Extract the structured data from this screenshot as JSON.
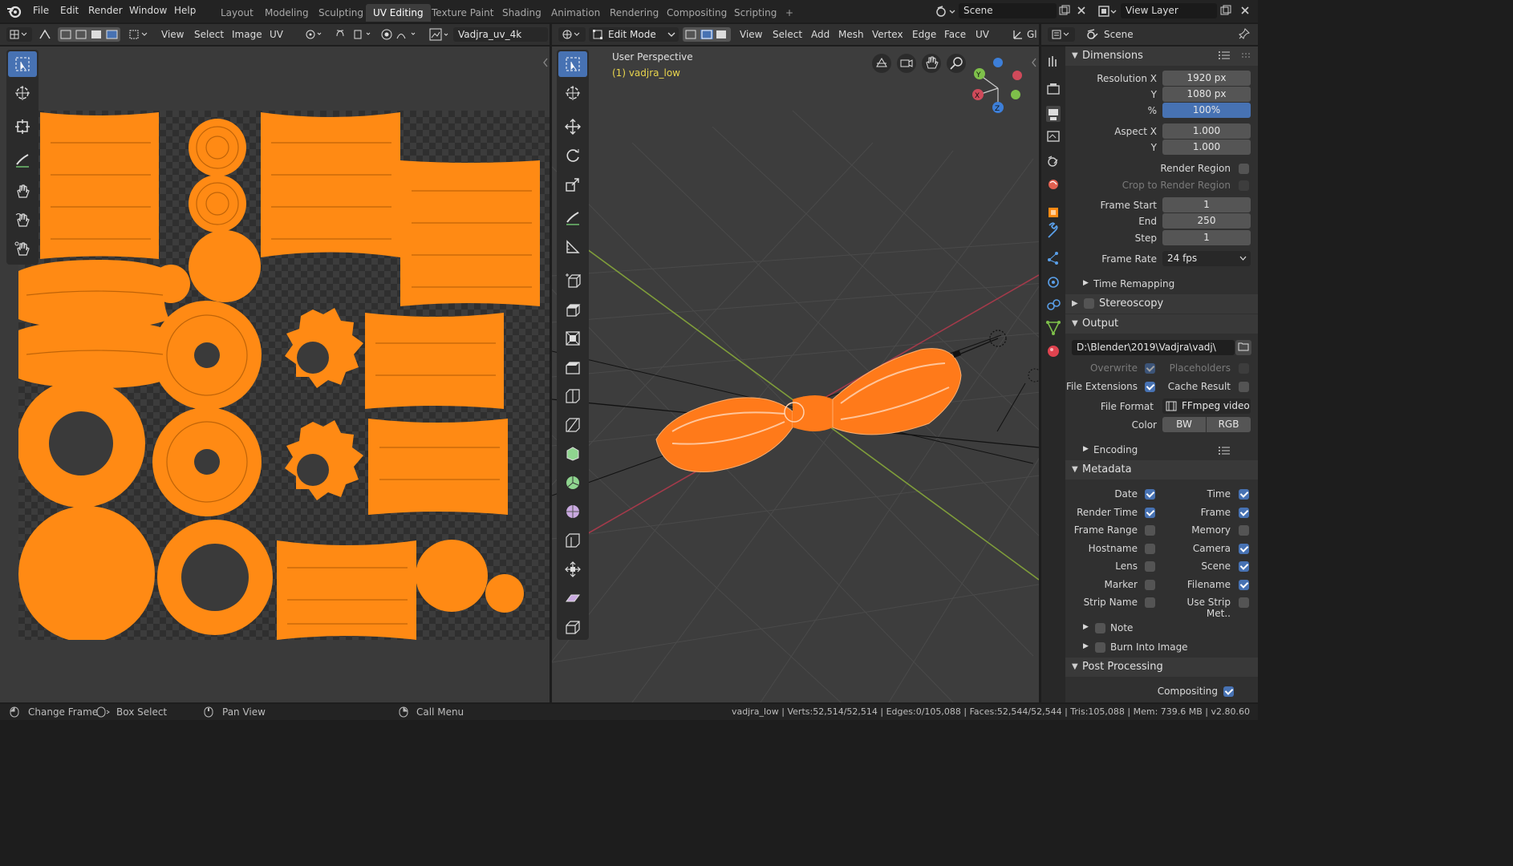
{
  "topbar": {
    "menus": [
      "File",
      "Edit",
      "Render",
      "Window",
      "Help"
    ],
    "workspaces": [
      "Layout",
      "Modeling",
      "Sculpting",
      "UV Editing",
      "Texture Paint",
      "Shading",
      "Animation",
      "Rendering",
      "Compositing",
      "Scripting"
    ],
    "active_workspace": "UV Editing",
    "add_tab": "+",
    "scene_name": "Scene",
    "view_layer": "View Layer"
  },
  "uv_editor": {
    "header_menus": [
      "View",
      "Select",
      "Image",
      "UV"
    ],
    "image_name": "Vadjra_uv_4k"
  },
  "viewport": {
    "mode": "Edit Mode",
    "header_menus": [
      "View",
      "Select",
      "Add",
      "Mesh",
      "Vertex",
      "Edge",
      "Face",
      "UV"
    ],
    "header_trailing": "Gl",
    "view_label": "User Perspective",
    "object_label": "(1) vadjra_low",
    "axes": {
      "x": "X",
      "y": "Y",
      "z": "Z"
    }
  },
  "properties": {
    "header_title": "Scene",
    "dimensions": {
      "title": "Dimensions",
      "resolution_x_label": "Resolution X",
      "resolution_x": "1920 px",
      "resolution_y_label": "Y",
      "resolution_y": "1080 px",
      "percent_label": "%",
      "percent": "100%",
      "aspect_x_label": "Aspect X",
      "aspect_x": "1.000",
      "aspect_y_label": "Y",
      "aspect_y": "1.000",
      "render_region": "Render Region",
      "crop_region": "Crop to Render Region",
      "frame_start_label": "Frame Start",
      "frame_start": "1",
      "end_label": "End",
      "end": "250",
      "step_label": "Step",
      "step": "1",
      "frame_rate_label": "Frame Rate",
      "frame_rate": "24 fps",
      "time_remapping": "Time Remapping"
    },
    "stereoscopy": "Stereoscopy",
    "output": {
      "title": "Output",
      "path": "D:\\Blender\\2019\\Vadjra\\vadj\\",
      "overwrite": "Overwrite",
      "placeholders": "Placeholders",
      "file_extensions": "File Extensions",
      "cache_result": "Cache Result",
      "file_format_label": "File Format",
      "file_format": "FFmpeg video",
      "color_label": "Color",
      "color_bw": "BW",
      "color_rgb": "RGB",
      "encoding": "Encoding"
    },
    "metadata": {
      "title": "Metadata",
      "date": "Date",
      "time": "Time",
      "render_time": "Render Time",
      "frame": "Frame",
      "frame_range": "Frame Range",
      "memory": "Memory",
      "hostname": "Hostname",
      "camera": "Camera",
      "lens": "Lens",
      "scene": "Scene",
      "marker": "Marker",
      "filename": "Filename",
      "strip_name": "Strip Name",
      "use_strip_meta": "Use Strip Met..",
      "note": "Note",
      "burn_into_image": "Burn Into Image"
    },
    "post_processing": {
      "title": "Post Processing",
      "compositing": "Compositing"
    }
  },
  "statusbar": {
    "change_frame": "Change Frame",
    "box_select": "Box Select",
    "pan_view": "Pan View",
    "call_menu": "Call Menu",
    "stats": "vadjra_low | Verts:52,514/52,514 | Edges:0/105,088 | Faces:52,544/52,544 | Tris:105,088 | Mem: 739.6 MB | v2.80.60"
  },
  "colors": {
    "accent": "#4772b3",
    "uv_island": "#ff8a14",
    "mesh_orange": "#ff7a1a"
  }
}
